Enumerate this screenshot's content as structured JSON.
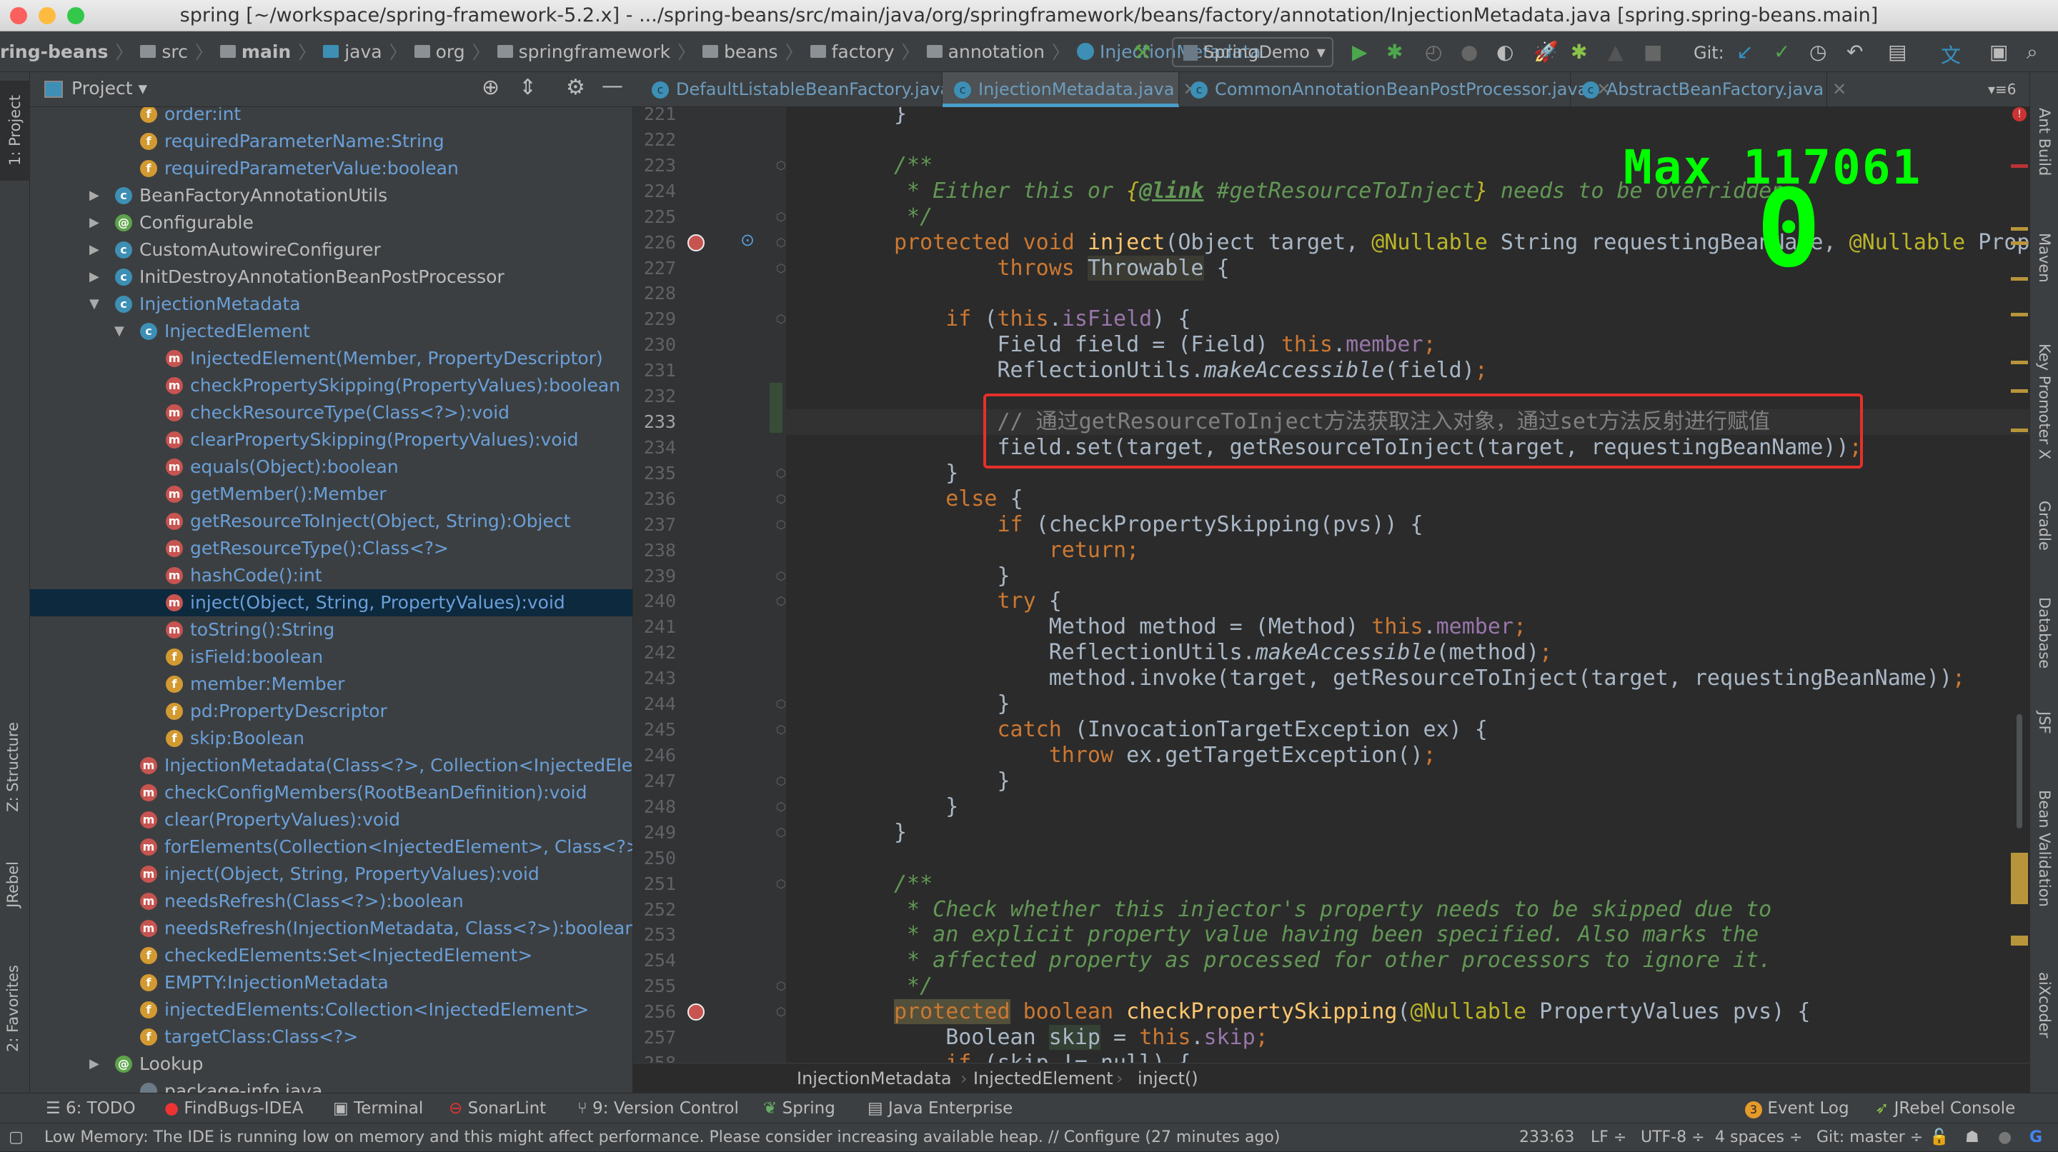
{
  "window": {
    "title": "spring [~/workspace/spring-framework-5.2.x] - .../spring-beans/src/main/java/org/springframework/beans/factory/annotation/InjectionMetadata.java [spring.spring-beans.main]"
  },
  "navbar": {
    "crumbs": [
      "ring-beans",
      "src",
      "main",
      "java",
      "org",
      "springframework",
      "beans",
      "factory",
      "annotation",
      "InjectionMetadata"
    ],
    "run_config": "SpringDemo",
    "git_label": "Git:"
  },
  "project_panel": {
    "title": "Project"
  },
  "tabs": [
    {
      "label": "DefaultListableBeanFactory.java",
      "active": false
    },
    {
      "label": "InjectionMetadata.java",
      "active": true
    },
    {
      "label": "CommonAnnotationBeanPostProcessor.java",
      "active": false
    },
    {
      "label": "AbstractBeanFactory.java",
      "active": false
    }
  ],
  "tab_overflow": "6",
  "tree": [
    {
      "label": "order:int",
      "icon": "f",
      "level": 2
    },
    {
      "label": "requiredParameterName:String",
      "icon": "f",
      "level": 2
    },
    {
      "label": "requiredParameterValue:boolean",
      "icon": "f",
      "level": 2
    },
    {
      "label": "BeanFactoryAnnotationUtils",
      "icon": "c",
      "level": 1,
      "arrow": "right"
    },
    {
      "label": "Configurable",
      "icon": "@",
      "level": 1,
      "arrow": "right"
    },
    {
      "label": "CustomAutowireConfigurer",
      "icon": "c",
      "level": 1,
      "arrow": "right"
    },
    {
      "label": "InitDestroyAnnotationBeanPostProcessor",
      "icon": "c",
      "level": 1,
      "arrow": "right"
    },
    {
      "label": "InjectionMetadata",
      "icon": "c",
      "level": 1,
      "arrow": "down",
      "blue": true
    },
    {
      "label": "InjectedElement",
      "icon": "c",
      "level": 2,
      "arrow": "down",
      "blue": true
    },
    {
      "label": "InjectedElement(Member, PropertyDescriptor)",
      "icon": "m",
      "level": 3
    },
    {
      "label": "checkPropertySkipping(PropertyValues):boolean",
      "icon": "m",
      "level": 3
    },
    {
      "label": "checkResourceType(Class<?>):void",
      "icon": "m",
      "level": 3
    },
    {
      "label": "clearPropertySkipping(PropertyValues):void",
      "icon": "m",
      "level": 3
    },
    {
      "label": "equals(Object):boolean",
      "icon": "m",
      "level": 3
    },
    {
      "label": "getMember():Member",
      "icon": "m",
      "level": 3
    },
    {
      "label": "getResourceToInject(Object, String):Object",
      "icon": "m",
      "level": 3
    },
    {
      "label": "getResourceType():Class<?>",
      "icon": "m",
      "level": 3
    },
    {
      "label": "hashCode():int",
      "icon": "m",
      "level": 3
    },
    {
      "label": "inject(Object, String, PropertyValues):void",
      "icon": "m",
      "level": 3,
      "selected": true
    },
    {
      "label": "toString():String",
      "icon": "m",
      "level": 3
    },
    {
      "label": "isField:boolean",
      "icon": "f",
      "level": 3
    },
    {
      "label": "member:Member",
      "icon": "f",
      "level": 3
    },
    {
      "label": "pd:PropertyDescriptor",
      "icon": "f",
      "level": 3
    },
    {
      "label": "skip:Boolean",
      "icon": "f",
      "level": 3
    },
    {
      "label": "InjectionMetadata(Class<?>, Collection<InjectedEleme",
      "icon": "m",
      "level": 2
    },
    {
      "label": "checkConfigMembers(RootBeanDefinition):void",
      "icon": "m",
      "level": 2
    },
    {
      "label": "clear(PropertyValues):void",
      "icon": "m",
      "level": 2
    },
    {
      "label": "forElements(Collection<InjectedElement>, Class<?>):I",
      "icon": "m",
      "level": 2
    },
    {
      "label": "inject(Object, String, PropertyValues):void",
      "icon": "m",
      "level": 2
    },
    {
      "label": "needsRefresh(Class<?>):boolean",
      "icon": "m",
      "level": 2
    },
    {
      "label": "needsRefresh(InjectionMetadata, Class<?>):boolean",
      "icon": "m",
      "level": 2
    },
    {
      "label": "checkedElements:Set<InjectedElement>",
      "icon": "f",
      "level": 2
    },
    {
      "label": "EMPTY:InjectionMetadata",
      "icon": "f",
      "level": 2
    },
    {
      "label": "injectedElements:Collection<InjectedElement>",
      "icon": "f",
      "level": 2
    },
    {
      "label": "targetClass:Class<?>",
      "icon": "f",
      "level": 2
    },
    {
      "label": "Lookup",
      "icon": "@",
      "level": 1,
      "arrow": "right"
    },
    {
      "label": "package-info.java",
      "icon": "p",
      "level": 2
    }
  ],
  "code": {
    "first_line": 221,
    "current_line": 233,
    "lines": [
      [
        [
          "t",
          "}"
        ]
      ],
      [],
      [
        [
          "c",
          "/**"
        ]
      ],
      [
        [
          "c",
          " * Either this or "
        ],
        [
          "cl",
          "{"
        ],
        [
          "ct",
          "@link"
        ],
        [
          "c",
          " #getResourceToInject"
        ],
        [
          "cl",
          "}"
        ],
        [
          "c",
          " needs to be overridden."
        ]
      ],
      [
        [
          "c",
          " */"
        ]
      ],
      [
        [
          "k",
          "protected void "
        ],
        [
          "m",
          "inject"
        ],
        [
          "t",
          "(Object target, "
        ],
        [
          "a",
          "@Nullable"
        ],
        [
          "t",
          " String requestingBeanName, "
        ],
        [
          "a",
          "@Nullable"
        ],
        [
          "t",
          " PropertyValues pvs)"
        ]
      ],
      [
        [
          "t",
          "        "
        ],
        [
          "k",
          "throws "
        ],
        [
          "th",
          "Throwable"
        ],
        [
          "t",
          " {"
        ]
      ],
      [],
      [
        [
          "t",
          "    "
        ],
        [
          "k",
          "if "
        ],
        [
          "t",
          "("
        ],
        [
          "k",
          "this"
        ],
        [
          "t",
          "."
        ],
        [
          "f",
          "isField"
        ],
        [
          "t",
          ") {"
        ]
      ],
      [
        [
          "t",
          "        Field field = (Field) "
        ],
        [
          "k",
          "this"
        ],
        [
          "t",
          "."
        ],
        [
          "f",
          "member"
        ],
        [
          "k",
          ";"
        ]
      ],
      [
        [
          "t",
          "        ReflectionUtils."
        ],
        [
          "i",
          "makeAccessible"
        ],
        [
          "t",
          "(field)"
        ],
        [
          "k",
          ";"
        ]
      ],
      [],
      [
        [
          "lc",
          "        // 通过getResourceToInject方法获取注入对象，通过set方法反射进行赋值"
        ]
      ],
      [
        [
          "t",
          "        field.set(target, getResourceToInject(target, requestingBeanName))"
        ],
        [
          "k",
          ";"
        ]
      ],
      [
        [
          "t",
          "    }"
        ]
      ],
      [
        [
          "t",
          "    "
        ],
        [
          "k",
          "else "
        ],
        [
          "t",
          "{"
        ]
      ],
      [
        [
          "t",
          "        "
        ],
        [
          "k",
          "if "
        ],
        [
          "t",
          "(checkPropertySkipping(pvs)) {"
        ]
      ],
      [
        [
          "t",
          "            "
        ],
        [
          "k",
          "return;"
        ]
      ],
      [
        [
          "t",
          "        }"
        ]
      ],
      [
        [
          "t",
          "        "
        ],
        [
          "k",
          "try "
        ],
        [
          "t",
          "{"
        ]
      ],
      [
        [
          "t",
          "            Method method = (Method) "
        ],
        [
          "k",
          "this"
        ],
        [
          "t",
          "."
        ],
        [
          "f",
          "member"
        ],
        [
          "k",
          ";"
        ]
      ],
      [
        [
          "t",
          "            ReflectionUtils."
        ],
        [
          "i",
          "makeAccessible"
        ],
        [
          "t",
          "(method)"
        ],
        [
          "k",
          ";"
        ]
      ],
      [
        [
          "t",
          "            method.invoke(target, getResourceToInject(target, requestingBeanName))"
        ],
        [
          "k",
          ";"
        ]
      ],
      [
        [
          "t",
          "        }"
        ]
      ],
      [
        [
          "t",
          "        "
        ],
        [
          "k",
          "catch "
        ],
        [
          "t",
          "(InvocationTargetException ex) {"
        ]
      ],
      [
        [
          "t",
          "            "
        ],
        [
          "k",
          "throw "
        ],
        [
          "t",
          "ex.getTargetException()"
        ],
        [
          "k",
          ";"
        ]
      ],
      [
        [
          "t",
          "        }"
        ]
      ],
      [
        [
          "t",
          "    }"
        ]
      ],
      [
        [
          "t",
          "}"
        ]
      ],
      [],
      [
        [
          "c",
          "/**"
        ]
      ],
      [
        [
          "c",
          " * Check whether this injector's property needs to be skipped due to"
        ]
      ],
      [
        [
          "c",
          " * an explicit property value having been specified. Also marks the"
        ]
      ],
      [
        [
          "c",
          " * affected property as processed for other processors to ignore it."
        ]
      ],
      [
        [
          "c",
          " */"
        ]
      ],
      [
        [
          "kh",
          "protected"
        ],
        [
          "k",
          " boolean "
        ],
        [
          "m",
          "checkPropertySkipping"
        ],
        [
          "t",
          "("
        ],
        [
          "a",
          "@Nullable"
        ],
        [
          "t",
          " PropertyValues pvs) {"
        ]
      ],
      [
        [
          "t",
          "    Boolean "
        ],
        [
          "sk",
          "skip"
        ],
        [
          "t",
          " = "
        ],
        [
          "k",
          "this"
        ],
        [
          "t",
          "."
        ],
        [
          "f",
          "skip"
        ],
        [
          "k",
          ";"
        ]
      ],
      [
        [
          "t",
          "    "
        ],
        [
          "k",
          "if "
        ],
        [
          "t",
          "(skip != null) {"
        ]
      ]
    ]
  },
  "overlay": {
    "max_label": "Max 117061",
    "value": "0"
  },
  "editor_breadcrumb": [
    "InjectionMetadata",
    "InjectedElement",
    "inject()"
  ],
  "left_strip": {
    "project": "1: Project",
    "structure": "Z: Structure",
    "jrebel": "JRebel",
    "favorites": "2: Favorites"
  },
  "right_strip": [
    "Ant Build",
    "Maven",
    "Key Promoter X",
    "Gradle",
    "Database",
    "JSF",
    "Bean Validation",
    "aiXcoder"
  ],
  "tool_windows": {
    "todo": "6: TODO",
    "findbugs": "FindBugs-IDEA",
    "terminal": "Terminal",
    "sonarlint": "SonarLint",
    "vcs": "9: Version Control",
    "spring": "Spring",
    "java_enterprise": "Java Enterprise",
    "event_log": "Event Log",
    "event_log_count": "3",
    "jrebel_console": "JRebel Console"
  },
  "status": {
    "message": "Low Memory: The IDE is running low on memory and this might affect performance. Please consider increasing available heap. // Configure (27 minutes ago)",
    "position": "233:63",
    "line_sep": "LF ÷",
    "encoding": "UTF-8 ÷",
    "indent": "4 spaces ÷",
    "git_branch": "Git: master ÷"
  },
  "colors": {
    "accent": "#4a9fc9",
    "selection": "#0d293e",
    "highlight_box": "#e5302a",
    "overlay": "#00ff00"
  }
}
